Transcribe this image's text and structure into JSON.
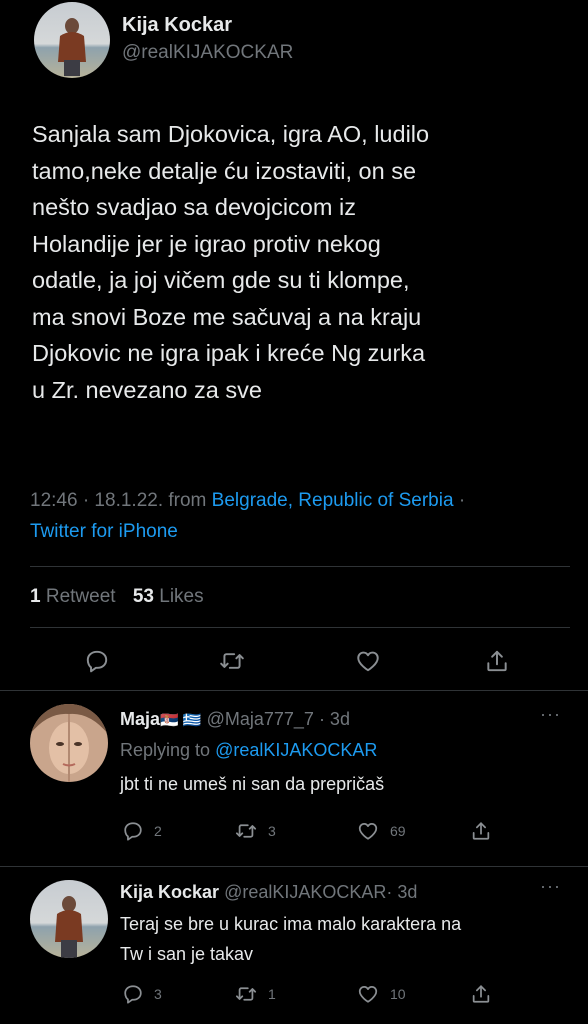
{
  "main_tweet": {
    "author_name": "Kija Kockar",
    "author_handle": "@realKIJAKOCKAR",
    "text_lines": [
      "Sanjala sam Djokovica, igra AO, ludilo",
      "tamo,neke detalje ću izostaviti, on se",
      "nešto svadjao sa devojcicom iz",
      "Holandije jer je igrao protiv nekog",
      "odatle, ja joj vičem gde su ti klompe,",
      "ma snovi Boze me sačuvaj a na kraju",
      "Djokovic ne igra ipak i kreće Ng zurka",
      "u Zr. nevezano za sve"
    ],
    "time": "12:46 · 18.1.22. from",
    "location": "Belgrade, Republic of Serbia",
    "location_dot": "·",
    "client": "Twitter for iPhone",
    "retweets_count": "1",
    "retweets_label": "Retweet",
    "likes_count": "53",
    "likes_label": "Likes"
  },
  "replies": [
    {
      "author_name": "Maja",
      "flags": "🇷🇸 🇬🇷",
      "author_handle": "@Maja777_7",
      "time": "· 3d",
      "replying_label": "Replying to",
      "replying_to": "@realKIJAKOCKAR",
      "text_lines": [
        "jbt ti ne umeš ni san da prepričaš"
      ],
      "reply_count": "2",
      "retweet_count": "3",
      "like_count": "69"
    },
    {
      "author_name": "Kija Kockar",
      "author_handle": "@realKIJAKOCKAR",
      "time": "· 3d",
      "text_lines": [
        "Teraj se bre u kurac ima malo karaktera na",
        "Tw i san je takav"
      ],
      "reply_count": "3",
      "retweet_count": "1",
      "like_count": "10"
    }
  ],
  "icons": {
    "reply": "reply-icon",
    "retweet": "retweet-icon",
    "like": "heart-icon",
    "share": "share-icon",
    "more": "more-icon"
  },
  "colors": {
    "background": "#000000",
    "text": "#e7e9ea",
    "muted": "#71767b",
    "link": "#1d9bf0",
    "divider": "#2f3336"
  }
}
